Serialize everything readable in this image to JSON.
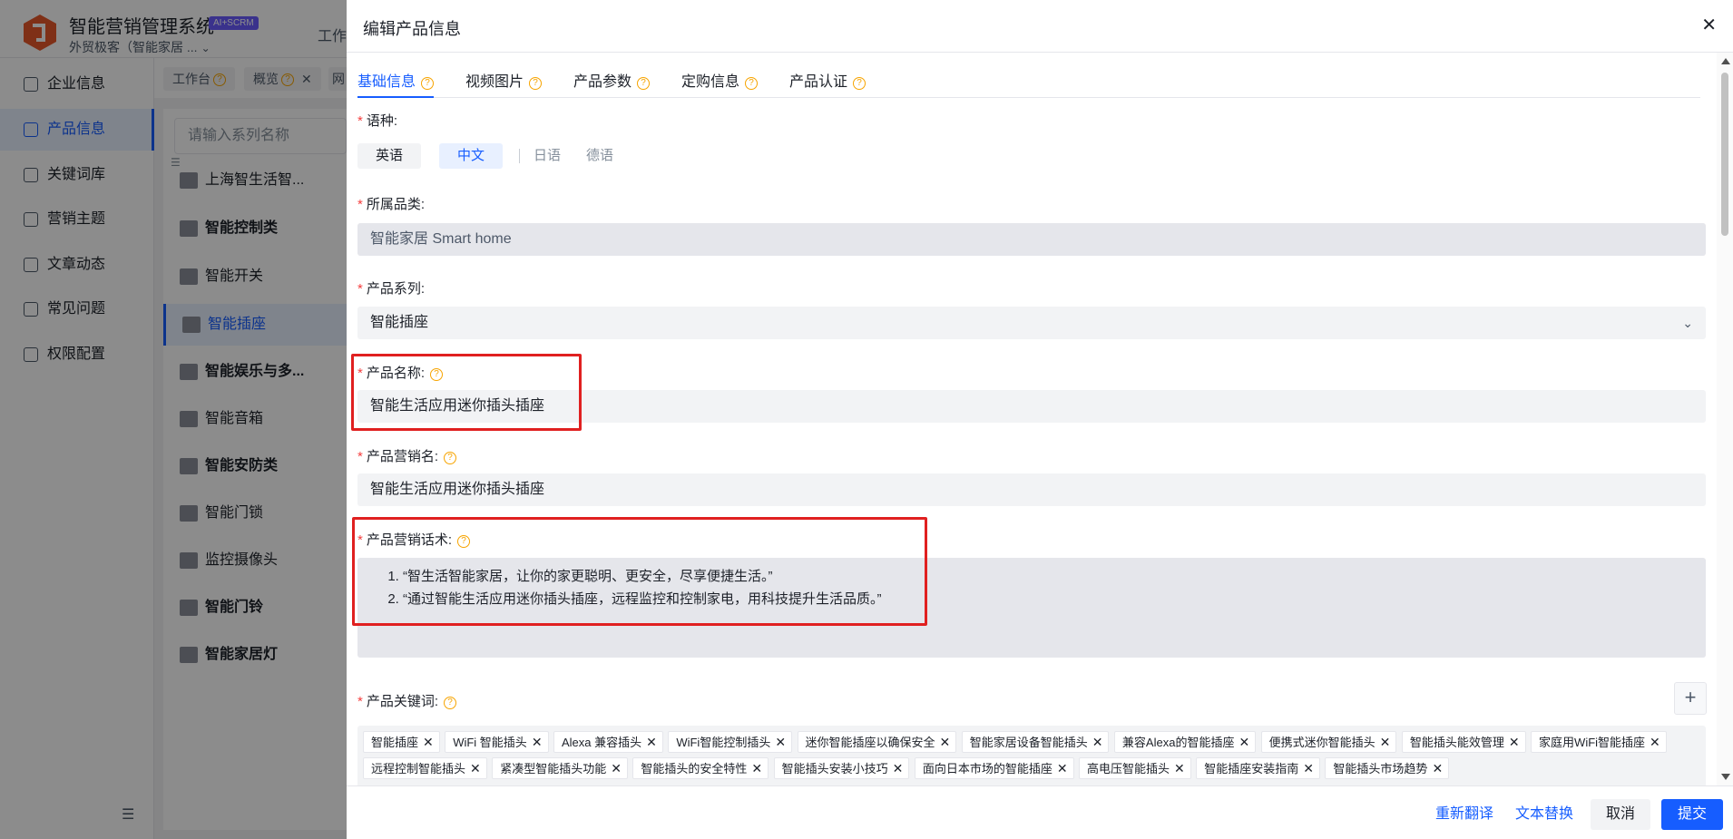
{
  "app": {
    "title": "智能营销管理系统",
    "badge": "AI+SCRM",
    "company": "外贸极客（智能家居 ...",
    "top_tab": "工作"
  },
  "sidebar": {
    "items": [
      {
        "label": "企业信息",
        "icon": "building-icon"
      },
      {
        "label": "产品信息",
        "icon": "grid-icon",
        "active": true
      },
      {
        "label": "关键词库",
        "icon": "tag-icon"
      },
      {
        "label": "营销主题",
        "icon": "megaphone-icon"
      },
      {
        "label": "文章动态",
        "icon": "document-icon"
      },
      {
        "label": "常见问题",
        "icon": "question-icon"
      },
      {
        "label": "权限配置",
        "icon": "shield-icon"
      }
    ]
  },
  "tabbar": {
    "tabs": [
      {
        "label": "工作台"
      },
      {
        "label": "概览"
      },
      {
        "label": "网"
      }
    ]
  },
  "series_panel": {
    "search_placeholder": "请输入系列名称",
    "items": [
      {
        "label": "上海智生活智...",
        "kind": "company"
      },
      {
        "label": "智能控制类",
        "kind": "group"
      },
      {
        "label": "智能开关",
        "kind": "sub"
      },
      {
        "label": "智能插座",
        "kind": "sub",
        "active": true
      },
      {
        "label": "智能娱乐与多...",
        "kind": "group"
      },
      {
        "label": "智能音箱",
        "kind": "sub"
      },
      {
        "label": "智能安防类",
        "kind": "group"
      },
      {
        "label": "智能门锁",
        "kind": "sub"
      },
      {
        "label": "监控摄像头",
        "kind": "sub"
      },
      {
        "label": "智能门铃",
        "kind": "group"
      },
      {
        "label": "智能家居灯",
        "kind": "group"
      }
    ]
  },
  "drawer": {
    "title": "编辑产品信息",
    "close_icon": "close-icon",
    "tabs": [
      "基础信息",
      "视频图片",
      "产品参数",
      "定购信息",
      "产品认证"
    ],
    "active_tab": 0,
    "language": {
      "label": "语种:",
      "options": [
        "英语",
        "中文",
        "日语",
        "德语"
      ],
      "selected": "中文"
    },
    "category": {
      "label": "所属品类:",
      "value": "智能家居 Smart home"
    },
    "series": {
      "label": "产品系列:",
      "value": "智能插座"
    },
    "product_name": {
      "label": "产品名称:",
      "value": "智能生活应用迷你插头插座"
    },
    "marketing_name": {
      "label": "产品营销名:",
      "value": "智能生活应用迷你插头插座"
    },
    "marketing_talk": {
      "label": "产品营销话术:",
      "lines": [
        "“智生活智能家居，让你的家更聪明、更安全，尽享便捷生活。”",
        "“通过智能生活应用迷你插头插座，远程监控和控制家电，用科技提升生活品质。”"
      ]
    },
    "keywords": {
      "label": "产品关键词:",
      "items": [
        "智能插座",
        "WiFi 智能插头",
        "Alexa 兼容插头",
        "WiFi智能控制插头",
        "迷你智能插座以确保安全",
        "智能家居设备智能插头",
        "兼容Alexa的智能插座",
        "便携式迷你智能插头",
        "智能插头能效管理",
        "家庭用WiFi智能插座",
        "远程控制智能插头",
        "紧凑型智能插头功能",
        "智能插头的安全特性",
        "智能插头安装小技巧",
        "面向日本市场的智能插座",
        "高电压智能插头",
        "智能插座安装指南",
        "智能插头市场趋势"
      ]
    },
    "footer": {
      "retranslate": "重新翻译",
      "replace_text": "文本替换",
      "cancel": "取消",
      "submit": "提交"
    }
  }
}
